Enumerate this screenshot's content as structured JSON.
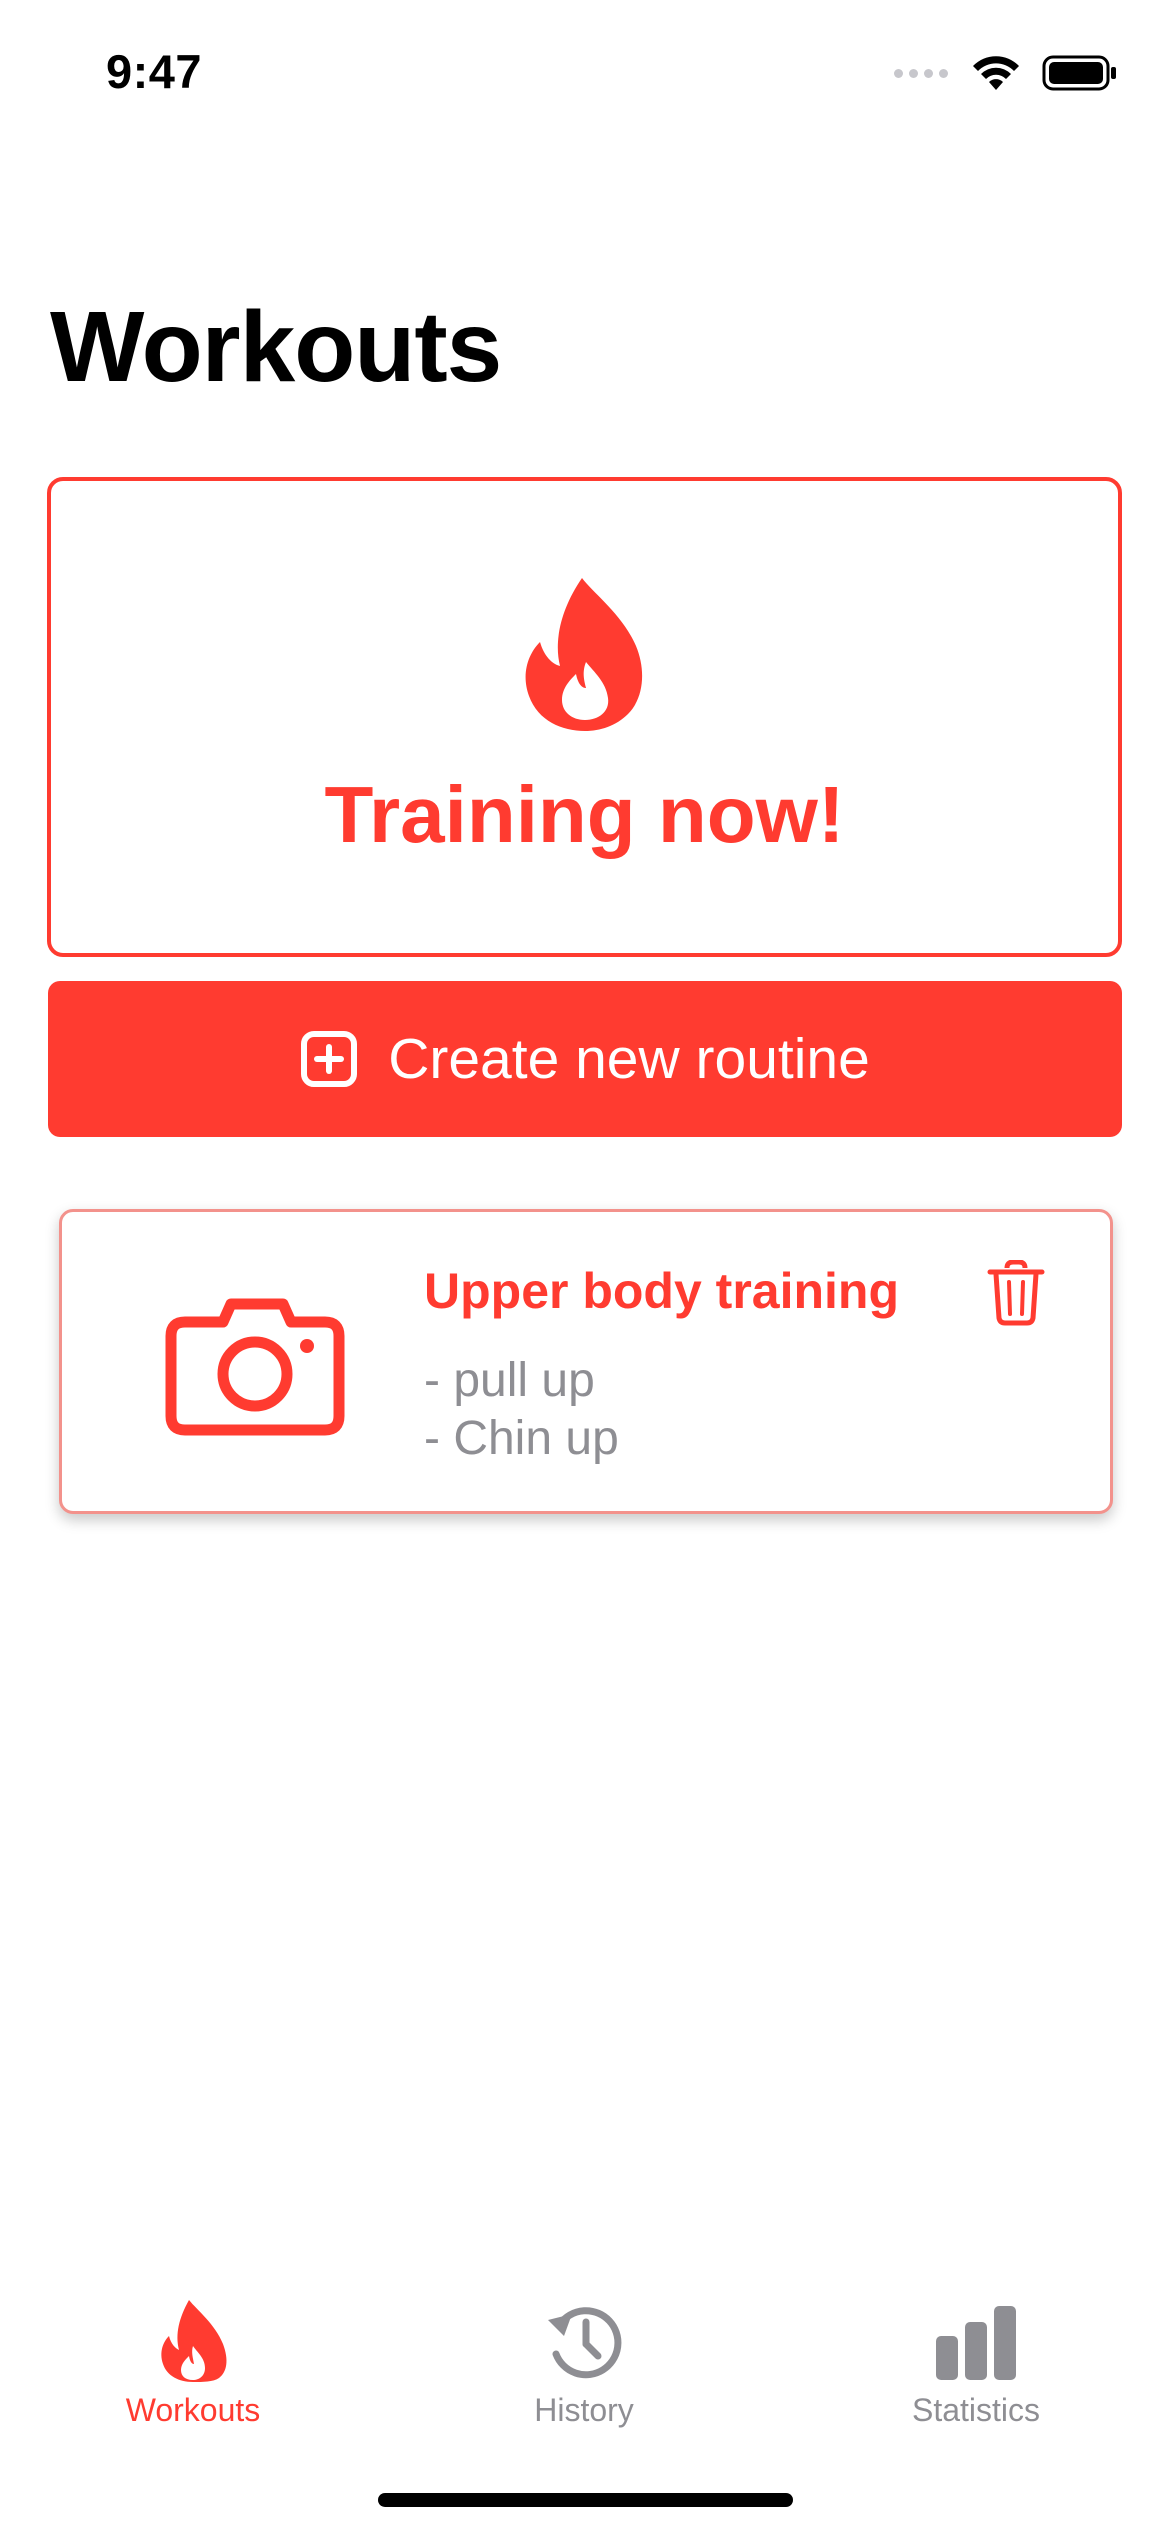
{
  "status_bar": {
    "time": "9:47"
  },
  "header": {
    "title": "Workouts"
  },
  "training_card": {
    "label": "Training now!",
    "icon": "flame-icon"
  },
  "create_button": {
    "label": "Create new routine",
    "icon": "plus-square-icon"
  },
  "routines": [
    {
      "title": "Upper body training",
      "exercises": [
        "- pull up",
        "- Chin up"
      ],
      "image_icon": "camera-icon",
      "delete_icon": "trash-icon"
    }
  ],
  "tab_bar": {
    "tabs": [
      {
        "label": "Workouts",
        "icon": "flame-icon",
        "active": true
      },
      {
        "label": "History",
        "icon": "history-icon",
        "active": false
      },
      {
        "label": "Statistics",
        "icon": "bar-chart-icon",
        "active": false
      }
    ]
  },
  "colors": {
    "accent": "#ff3b30",
    "secondary_text": "#8e8e93",
    "card_border": "#f3928c"
  }
}
